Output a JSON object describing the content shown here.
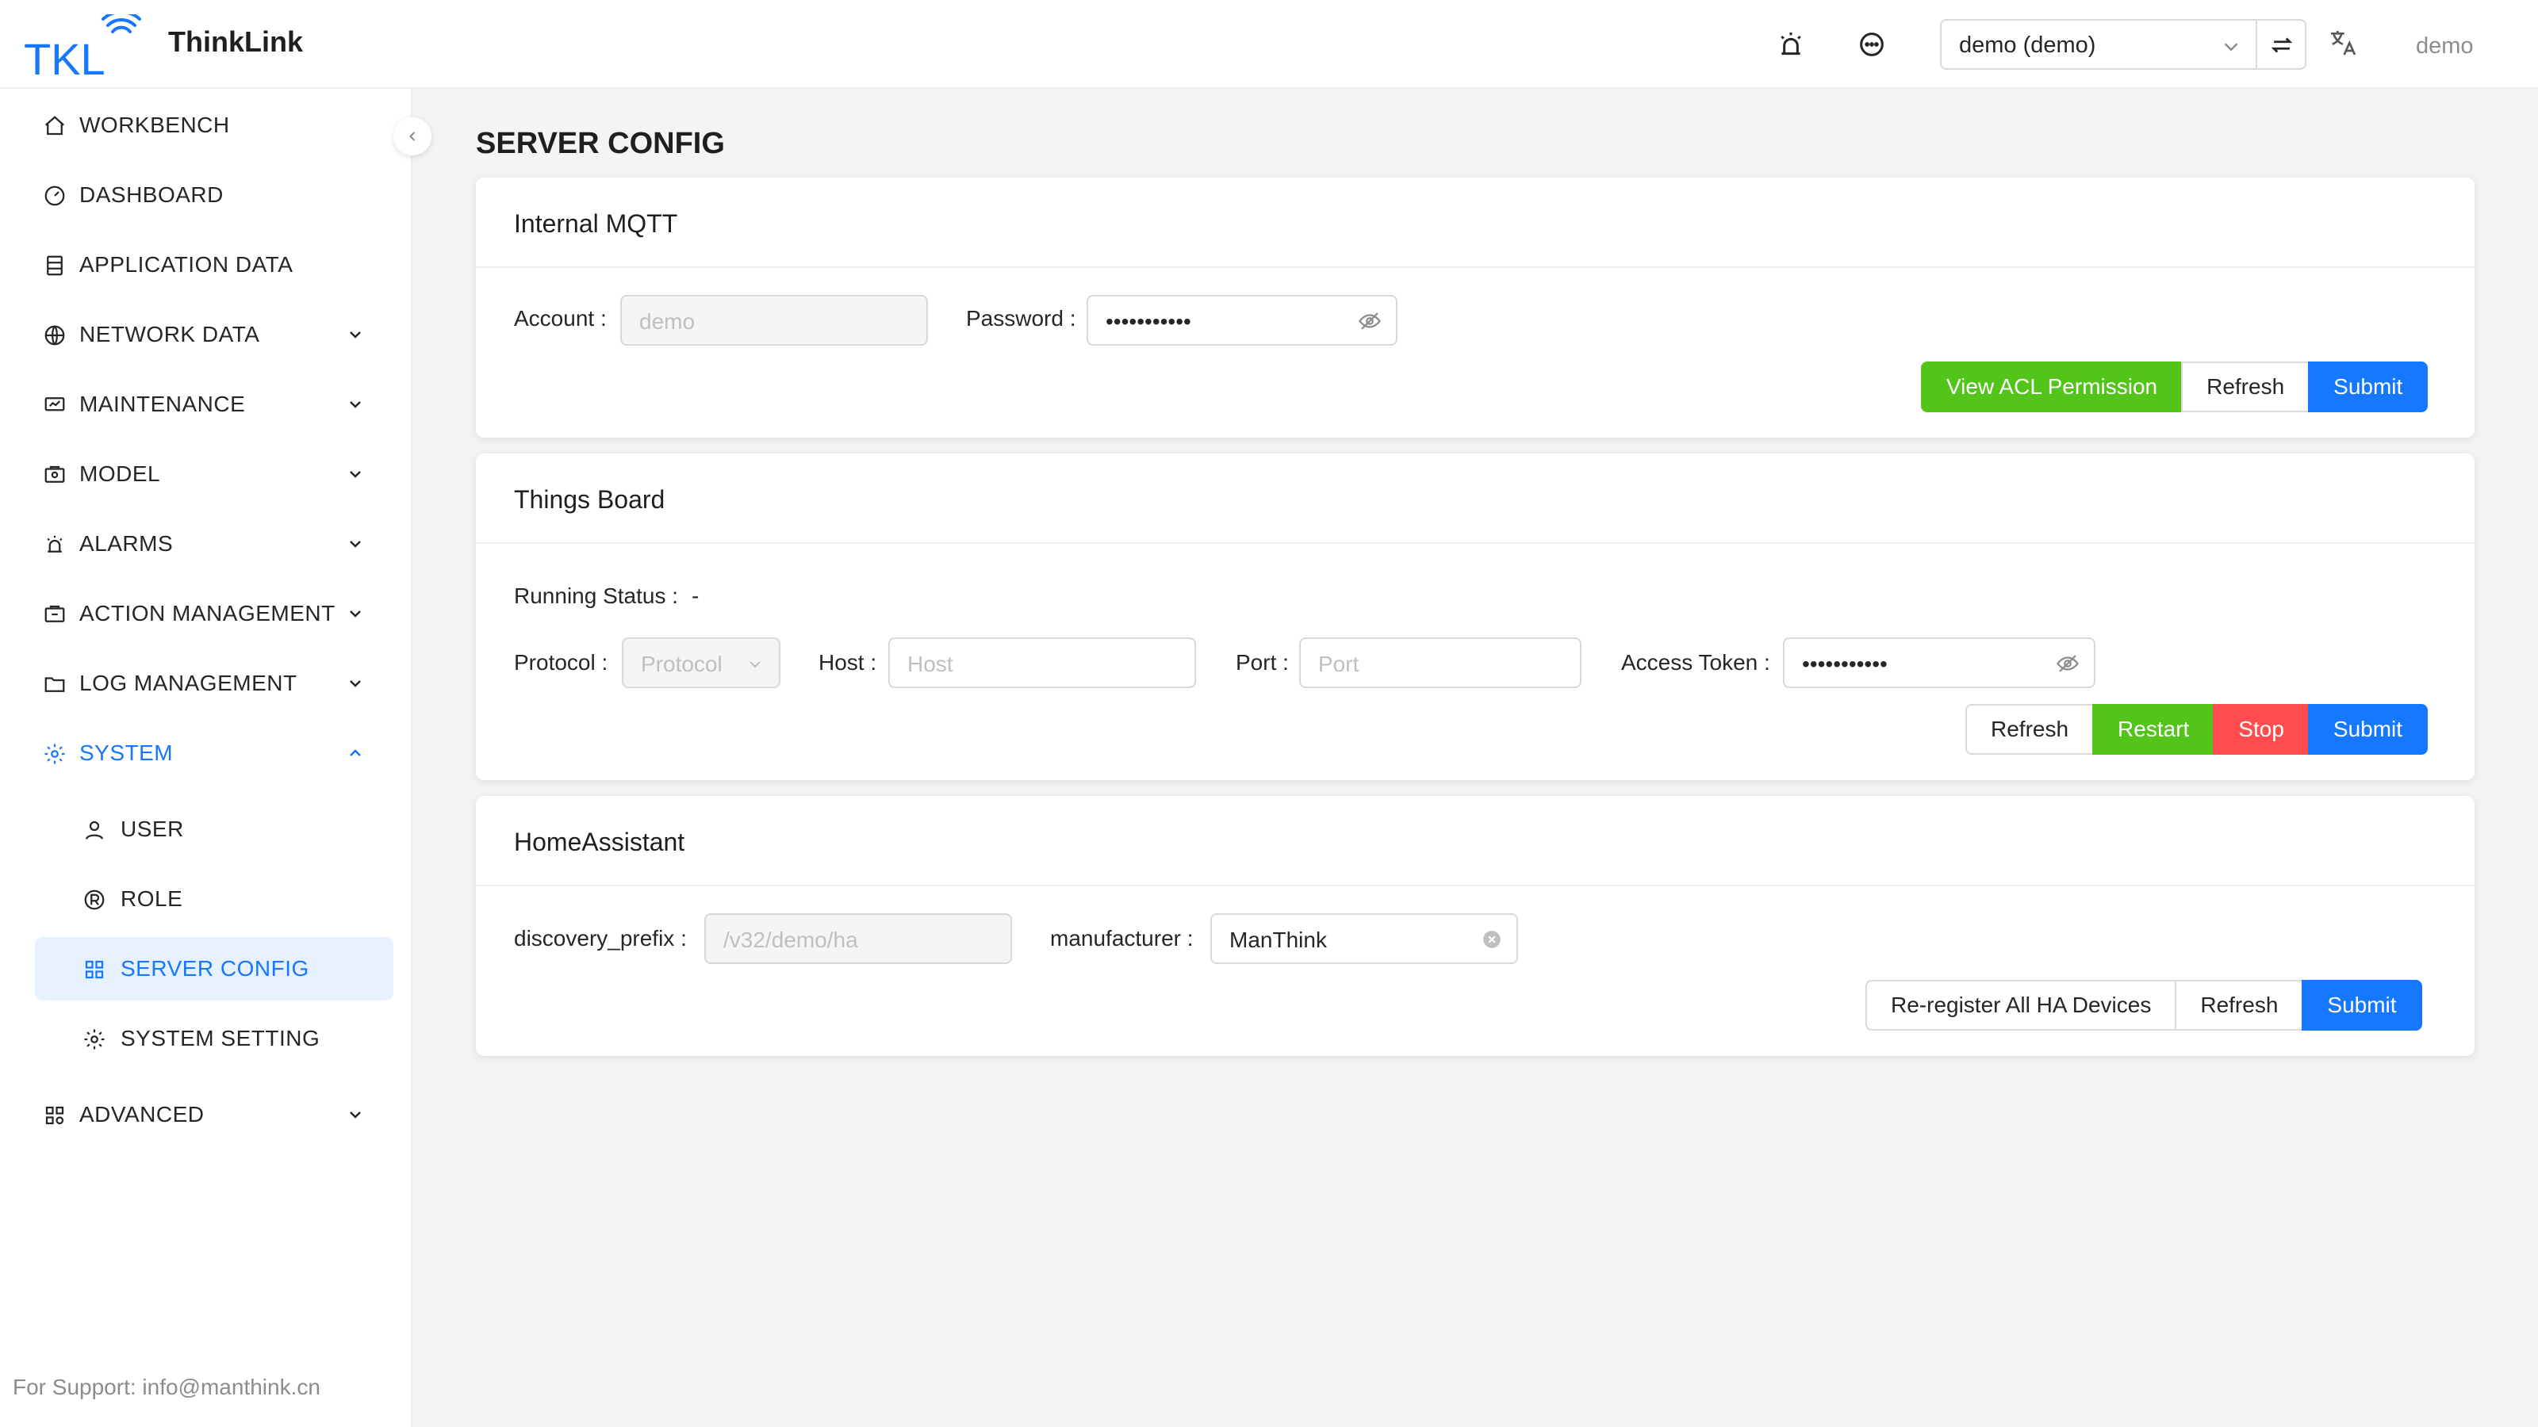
{
  "app": {
    "brand_name": "ThinkLink",
    "logo_text": "TKL",
    "tenant_selected": "demo (demo)",
    "user_name": "demo",
    "support_text": "For Support: info@manthink.cn"
  },
  "sidebar": {
    "items": [
      {
        "label": "WORKBENCH",
        "icon": "home-icon"
      },
      {
        "label": "DASHBOARD",
        "icon": "dashboard-icon"
      },
      {
        "label": "APPLICATION DATA",
        "icon": "database-icon"
      },
      {
        "label": "NETWORK DATA",
        "icon": "globe-icon",
        "expandable": true
      },
      {
        "label": "MAINTENANCE",
        "icon": "monitor-icon",
        "expandable": true
      },
      {
        "label": "MODEL",
        "icon": "model-icon",
        "expandable": true
      },
      {
        "label": "ALARMS",
        "icon": "alarm-icon",
        "expandable": true
      },
      {
        "label": "ACTION MANAGEMENT",
        "icon": "action-icon",
        "expandable": true
      },
      {
        "label": "LOG MANAGEMENT",
        "icon": "folder-icon",
        "expandable": true
      },
      {
        "label": "SYSTEM",
        "icon": "gear-icon",
        "expanded": true
      },
      {
        "label": "USER",
        "icon": "user-icon",
        "sub": true
      },
      {
        "label": "ROLE",
        "icon": "role-icon",
        "sub": true
      },
      {
        "label": "SERVER CONFIG",
        "icon": "grid-icon",
        "sub": true,
        "selected": true
      },
      {
        "label": "SYSTEM SETTING",
        "icon": "gear-icon",
        "sub": true
      },
      {
        "label": "ADVANCED",
        "icon": "apps-icon",
        "expandable": true
      }
    ]
  },
  "page": {
    "title": "SERVER CONFIG"
  },
  "mqtt": {
    "title": "Internal MQTT",
    "account_label": "Account",
    "account_value": "demo",
    "password_label": "Password",
    "password_value": "•••••••••••",
    "view_acl_label": "View ACL Permission",
    "refresh_label": "Refresh",
    "submit_label": "Submit"
  },
  "thingsboard": {
    "title": "Things Board",
    "running_status_label": "Running Status",
    "running_status_value": "-",
    "protocol_label": "Protocol",
    "protocol_placeholder": "Protocol",
    "host_label": "Host",
    "host_placeholder": "Host",
    "port_label": "Port",
    "port_placeholder": "Port",
    "token_label": "Access Token",
    "token_value": "•••••••••••",
    "refresh_label": "Refresh",
    "restart_label": "Restart",
    "stop_label": "Stop",
    "submit_label": "Submit"
  },
  "homeassistant": {
    "title": "HomeAssistant",
    "prefix_label": "discovery_prefix",
    "prefix_value": "/v32/demo/ha",
    "manufacturer_label": "manufacturer",
    "manufacturer_value": "ManThink",
    "reregister_label": "Re-register All HA Devices",
    "refresh_label": "Refresh",
    "submit_label": "Submit"
  },
  "colors": {
    "primary": "#1677ff",
    "success": "#52c41a",
    "danger": "#ff4d4f",
    "selected_bg": "#e6f0ff"
  }
}
